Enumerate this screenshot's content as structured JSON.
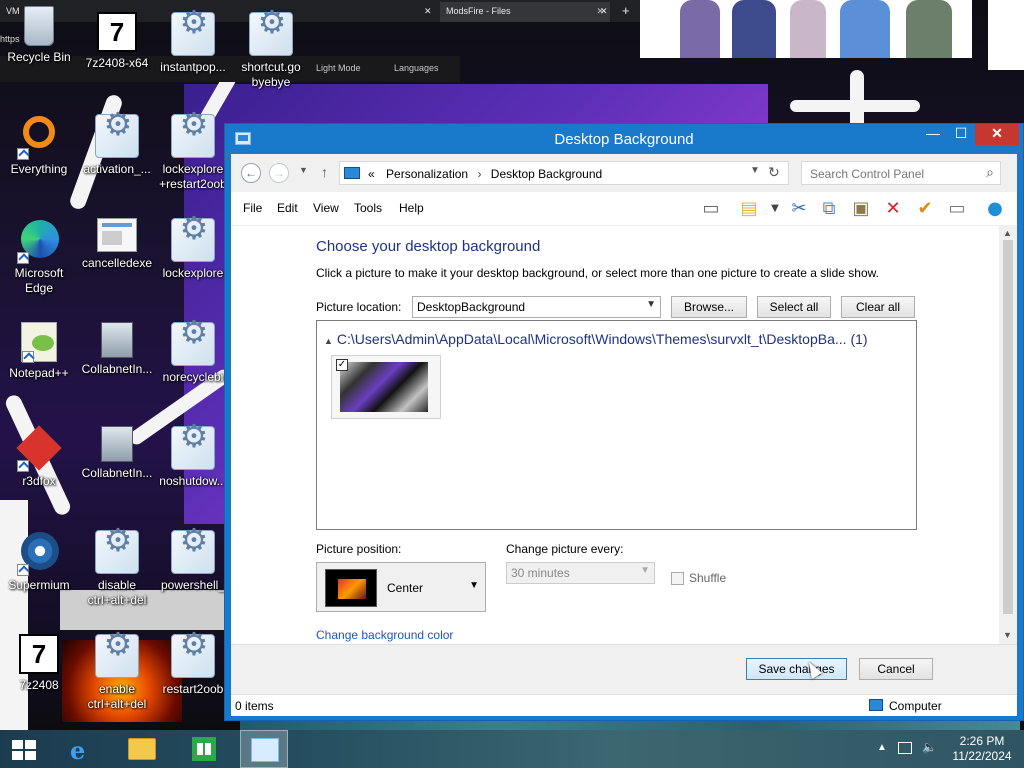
{
  "browser": {
    "tab_left_label": "VM",
    "tab_mid_label": "ModsFire - Files",
    "address_fragment": "https",
    "toolbar_light_mode": "Light Mode",
    "toolbar_languages": "Languages"
  },
  "desktop": {
    "icons": [
      {
        "label": "Recycle Bin",
        "icon": "recycle-bin-icon"
      },
      {
        "label": "7z2408-x64",
        "icon": "7zip-icon"
      },
      {
        "label": "instantpop...",
        "icon": "script-gear-icon"
      },
      {
        "label": "shortcut.go byebye",
        "icon": "script-gear-icon"
      },
      {
        "label": "Everything",
        "icon": "everything-search-icon"
      },
      {
        "label": "activation_...",
        "icon": "script-gear-icon"
      },
      {
        "label": "lockexplore +restart2oob",
        "icon": "script-gear-icon"
      },
      {
        "label": "Microsoft Edge",
        "icon": "edge-icon"
      },
      {
        "label": "cancelledexe",
        "icon": "document-icon"
      },
      {
        "label": "lockexplore",
        "icon": "script-gear-icon"
      },
      {
        "label": "Notepad++",
        "icon": "notepadpp-icon"
      },
      {
        "label": "CollabnetIn...",
        "icon": "installer-icon"
      },
      {
        "label": "norecyclebi",
        "icon": "script-gear-icon"
      },
      {
        "label": "r3dfox",
        "icon": "r3dfox-icon"
      },
      {
        "label": "CollabnetIn...",
        "icon": "installer-icon"
      },
      {
        "label": "noshutdow...",
        "icon": "script-gear-icon"
      },
      {
        "label": "Supermium",
        "icon": "supermium-icon"
      },
      {
        "label": "disable ctrl+alt+del",
        "icon": "script-gear-icon"
      },
      {
        "label": "powershell_",
        "icon": "script-gear-icon"
      },
      {
        "label": "7z2408",
        "icon": "7zip-icon"
      },
      {
        "label": "enable ctrl+alt+del",
        "icon": "script-gear-icon"
      },
      {
        "label": "restart2oob",
        "icon": "script-gear-icon"
      }
    ]
  },
  "window": {
    "title": "Desktop Background",
    "minimize": "—",
    "maximize": "☐",
    "close": "✕",
    "breadcrumb": {
      "prefix": "«",
      "items": [
        "Personalization",
        "Desktop Background"
      ]
    },
    "search_placeholder": "Search Control Panel",
    "menu": [
      "File",
      "Edit",
      "View",
      "Tools",
      "Help"
    ],
    "heading": "Choose your desktop background",
    "subheading": "Click a picture to make it your desktop background, or select more than one picture to create a slide show.",
    "picture_location_label": "Picture location:",
    "picture_location_value": "DesktopBackground",
    "browse_label": "Browse...",
    "select_all_label": "Select all",
    "clear_all_label": "Clear all",
    "gallery_group": "C:\\Users\\Admin\\AppData\\Local\\Microsoft\\Windows\\Themes\\survxlt_t\\DesktopBa... (1)",
    "thumbnail_checked": "✓",
    "picture_position_label": "Picture position:",
    "picture_position_value": "Center",
    "change_every_label": "Change picture every:",
    "change_every_value": "30 minutes",
    "shuffle_label": "Shuffle",
    "change_color_link": "Change background color",
    "save_label": "Save changes",
    "cancel_label": "Cancel",
    "status_items": "0 items",
    "status_location": "Computer"
  },
  "taskbar": {
    "clock_time": "2:26 PM",
    "clock_date": "11/22/2024"
  },
  "colors": {
    "titlebar": "#1979ca",
    "close": "#c7372f",
    "heading": "#1e3287",
    "link": "#1e56c0"
  }
}
